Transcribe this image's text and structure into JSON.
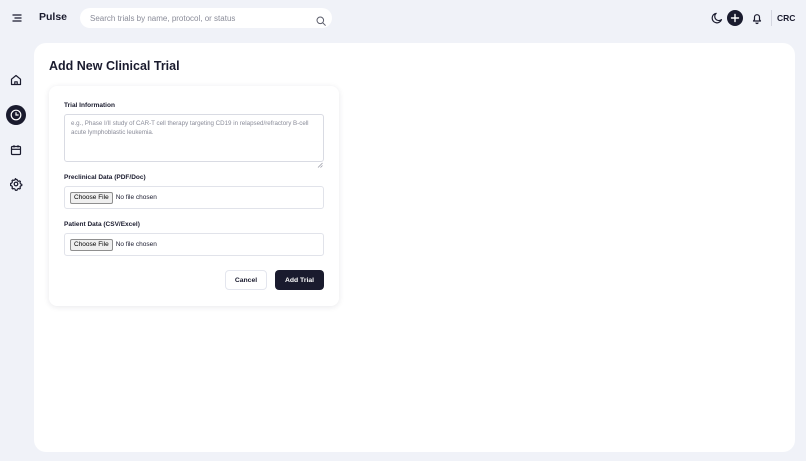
{
  "app": {
    "name": "Pulse",
    "user_initials": "CRC"
  },
  "search": {
    "placeholder": "Search trials by name, protocol, or status"
  },
  "icons": {
    "menu": "menu-toggle-icon",
    "search": "search-icon",
    "theme": "moon-icon",
    "add": "plus-icon",
    "notifications": "bell-icon",
    "sidebar": [
      "home-icon",
      "dashboard-icon",
      "calendar-icon",
      "settings-icon"
    ]
  },
  "colors": {
    "accent": "#1a1b2e",
    "background": "#f0f2f8",
    "panel": "#ffffff"
  },
  "page": {
    "title": "Add New Clinical Trial"
  },
  "form": {
    "trial_info_label": "Trial Information",
    "trial_info_placeholder": "e.g., Phase I/II study of CAR-T cell therapy targeting CD19 in relapsed/refractory B-cell acute lymphoblastic leukemia.",
    "preclinical_label": "Preclinical Data (PDF/Doc)",
    "patient_label": "Patient Data (CSV/Excel)",
    "choose_file_label": "Choose File",
    "no_file_text": "No file chosen",
    "cancel_label": "Cancel",
    "submit_label": "Add Trial"
  }
}
